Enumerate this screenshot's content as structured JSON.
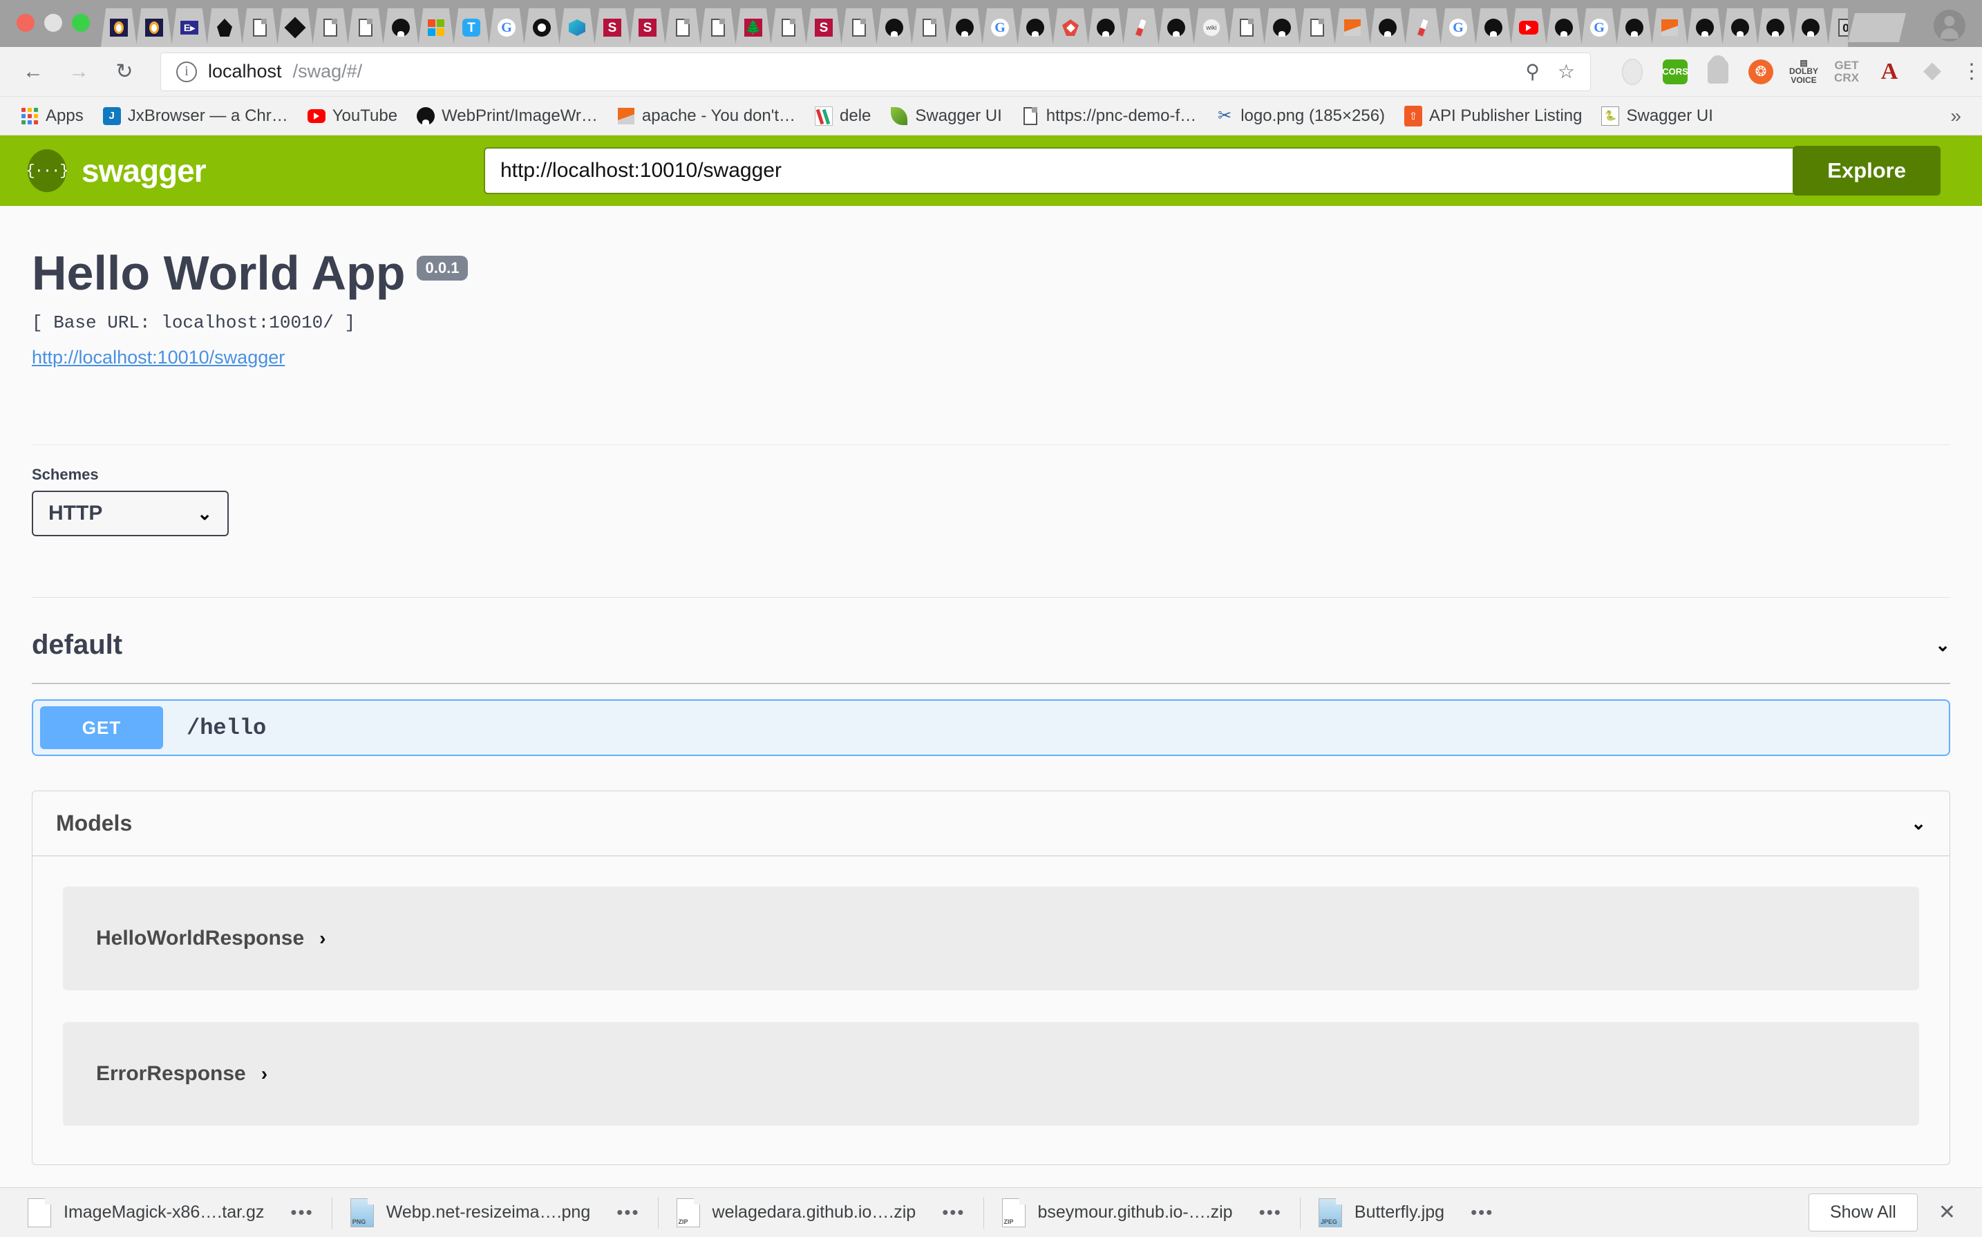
{
  "browser": {
    "window_controls": [
      "close",
      "minimize",
      "maximize"
    ],
    "tabs": [
      {
        "icon": "opera-icon",
        "type": "opera"
      },
      {
        "icon": "opera-icon",
        "type": "opera"
      },
      {
        "icon": "arrow-box-icon",
        "type": "arrow"
      },
      {
        "icon": "ink-pen-icon",
        "type": "pen"
      },
      {
        "icon": "document-icon",
        "type": "doc"
      },
      {
        "icon": "diamond-icon",
        "type": "diamond"
      },
      {
        "icon": "document-icon",
        "type": "doc"
      },
      {
        "icon": "document-icon",
        "type": "doc"
      },
      {
        "icon": "github-icon",
        "type": "github"
      },
      {
        "icon": "microsoft-icon",
        "type": "microsoft"
      },
      {
        "icon": "teams-icon",
        "type": "teams"
      },
      {
        "icon": "google-icon",
        "type": "google"
      },
      {
        "icon": "cbs-eye-icon",
        "type": "eye"
      },
      {
        "icon": "teal-hex-icon",
        "type": "teal"
      },
      {
        "icon": "stanford-icon",
        "type": "stanford"
      },
      {
        "icon": "stanford-icon",
        "type": "stanford"
      },
      {
        "icon": "document-icon",
        "type": "doc"
      },
      {
        "icon": "document-icon",
        "type": "doc"
      },
      {
        "icon": "stanford-tree-icon",
        "type": "tree"
      },
      {
        "icon": "document-icon",
        "type": "doc"
      },
      {
        "icon": "stanford-icon",
        "type": "stanford"
      },
      {
        "icon": "document-icon",
        "type": "doc"
      },
      {
        "icon": "github-icon",
        "type": "github"
      },
      {
        "icon": "document-icon",
        "type": "doc"
      },
      {
        "icon": "github-icon",
        "type": "github"
      },
      {
        "icon": "google-icon",
        "type": "google"
      },
      {
        "icon": "github-icon",
        "type": "github"
      },
      {
        "icon": "ruby-icon",
        "type": "ruby"
      },
      {
        "icon": "github-icon",
        "type": "github"
      },
      {
        "icon": "lab-tube-icon",
        "type": "lab"
      },
      {
        "icon": "github-icon",
        "type": "github"
      },
      {
        "icon": "wiki-icon",
        "type": "wiki"
      },
      {
        "icon": "document-icon",
        "type": "doc"
      },
      {
        "icon": "github-icon",
        "type": "github"
      },
      {
        "icon": "document-icon",
        "type": "doc"
      },
      {
        "icon": "apache-icon",
        "type": "apache"
      },
      {
        "icon": "github-icon",
        "type": "github"
      },
      {
        "icon": "lab-tube-icon",
        "type": "lab"
      },
      {
        "icon": "google-icon",
        "type": "google"
      },
      {
        "icon": "github-icon",
        "type": "github"
      },
      {
        "icon": "youtube-icon",
        "type": "youtube"
      },
      {
        "icon": "github-icon",
        "type": "github"
      },
      {
        "icon": "google-icon",
        "type": "google"
      },
      {
        "icon": "github-icon",
        "type": "github"
      },
      {
        "icon": "apache-icon",
        "type": "apache"
      },
      {
        "icon": "github-icon",
        "type": "github"
      },
      {
        "icon": "github-icon",
        "type": "github"
      },
      {
        "icon": "github-icon",
        "type": "github"
      },
      {
        "icon": "github-icon",
        "type": "github"
      },
      {
        "icon": "zero-icon",
        "type": "zero"
      },
      {
        "icon": "github-icon",
        "type": "github"
      }
    ],
    "active_tab": {
      "close_label": "×"
    },
    "toolbar": {
      "back": "←",
      "forward": "→",
      "reload": "↻",
      "url_host": "localhost",
      "url_path": "/swag/#/",
      "zoom_icon": "zoom-in-icon",
      "bookmark_icon": "star-icon",
      "extensions": [
        "opera-ext",
        "CORS",
        "android-ext",
        "orange-ext",
        "DOLBY VOICE",
        "GET CRX",
        "A",
        "diamond-ext"
      ],
      "menu": "⋮"
    },
    "bookmarks": [
      {
        "label": "Apps",
        "icon": "apps-grid-icon"
      },
      {
        "label": "JxBrowser — a Chr…",
        "icon": "jxbrowser-icon"
      },
      {
        "label": "YouTube",
        "icon": "youtube-icon"
      },
      {
        "label": "WebPrint/ImageWr…",
        "icon": "github-icon"
      },
      {
        "label": "apache - You don't…",
        "icon": "apache-icon"
      },
      {
        "label": "dele",
        "icon": "dele-icon"
      },
      {
        "label": "Swagger UI",
        "icon": "leaf-icon"
      },
      {
        "label": "https://pnc-demo-f…",
        "icon": "document-icon"
      },
      {
        "label": "logo.png (185×256)",
        "icon": "scissors-icon"
      },
      {
        "label": "API Publisher Listing",
        "icon": "api-publisher-icon"
      },
      {
        "label": "Swagger UI",
        "icon": "swagger-icon"
      }
    ],
    "bookmarks_overflow": "»"
  },
  "swagger": {
    "brand": {
      "logo_glyph": "{···}",
      "word": "swagger"
    },
    "explore": {
      "url_value": "http://localhost:10010/swagger",
      "url_placeholder": "",
      "button_label": "Explore"
    },
    "info": {
      "title": "Hello World App",
      "version": "0.0.1",
      "base_url": "[ Base URL: localhost:10010/ ]",
      "spec_link": "http://localhost:10010/swagger"
    },
    "schemes": {
      "label": "Schemes",
      "selected": "HTTP",
      "options": [
        "HTTP"
      ],
      "caret": "⌄"
    },
    "tags": [
      {
        "name": "default",
        "collapse_caret": "⌄",
        "operations": [
          {
            "method": "GET",
            "path": "/hello",
            "summary": ""
          }
        ]
      }
    ],
    "models": {
      "title": "Models",
      "collapse_caret": "⌄",
      "items": [
        {
          "name": "HelloWorldResponse",
          "caret": "›"
        },
        {
          "name": "ErrorResponse",
          "caret": "›"
        }
      ]
    },
    "colors": {
      "brand_green": "#89bf04",
      "explore_green": "#547f00",
      "get_blue": "#61affe",
      "get_bg": "#ebf3fb",
      "title_slate": "#3b4151",
      "link_blue": "#4990e2"
    }
  },
  "downloads": {
    "items": [
      {
        "name": "ImageMagick-x86….tar.gz",
        "type": "archive",
        "ftype": ""
      },
      {
        "name": "Webp.net-resizeima….png",
        "type": "image",
        "ftype": "PNG"
      },
      {
        "name": "welagedara.github.io….zip",
        "type": "zip",
        "ftype": "ZIP"
      },
      {
        "name": "bseymour.github.io-….zip",
        "type": "zip",
        "ftype": "ZIP"
      },
      {
        "name": "Butterfly.jpg",
        "type": "image",
        "ftype": "JPEG"
      }
    ],
    "menu_glyph": "•••",
    "show_all_label": "Show All",
    "close_label": "✕"
  }
}
